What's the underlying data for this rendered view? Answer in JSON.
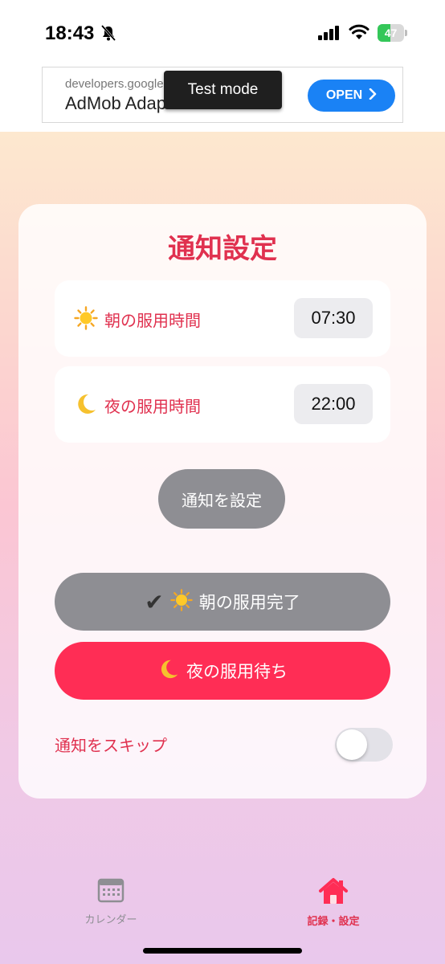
{
  "status_bar": {
    "time": "18:43",
    "battery_level": "47",
    "battery_fraction": 0.47
  },
  "ad": {
    "url": "developers.google",
    "title": "AdMob Adap",
    "open_label": "OPEN",
    "test_mode_label": "Test mode"
  },
  "card": {
    "title": "通知設定",
    "morning": {
      "icon": "sun-icon",
      "label": "朝の服用時間",
      "time": "07:30"
    },
    "night": {
      "icon": "moon-icon",
      "label": "夜の服用時間",
      "time": "22:00"
    },
    "set_button": "通知を設定",
    "morning_done_check": "✔",
    "morning_done_label": "朝の服用完了",
    "night_wait_label": "夜の服用待ち",
    "skip_label": "通知をスキップ",
    "skip_enabled": false
  },
  "tabs": [
    {
      "label": "カレンダー",
      "icon": "calendar-icon",
      "active": false
    },
    {
      "label": "記録・設定",
      "icon": "home-icon",
      "active": true
    }
  ],
  "colors": {
    "accent": "#e0314f",
    "primary_button": "#ff2d55",
    "disabled_button": "#8e8e93",
    "ad_button": "#1a82f5"
  }
}
